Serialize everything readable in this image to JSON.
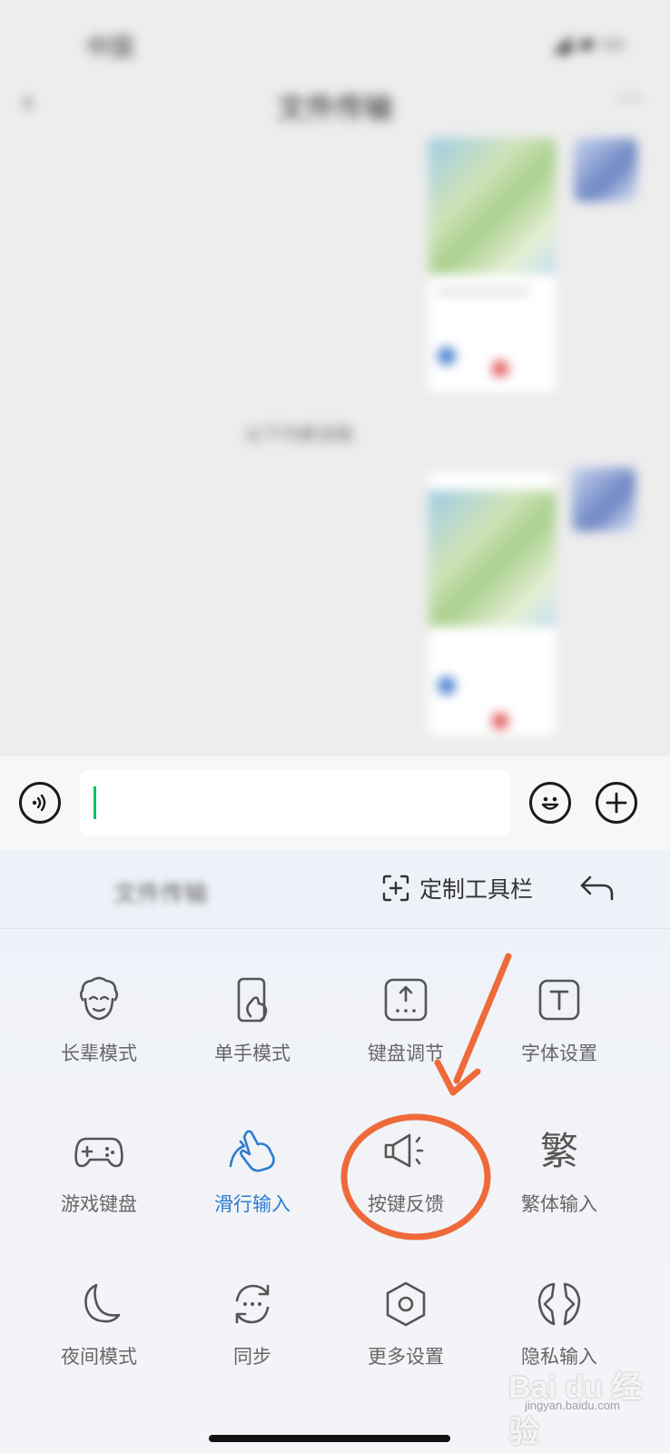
{
  "chat": {
    "status_time": "中国",
    "status_icons": "◢ ▰ ▭",
    "nav_back": "‹",
    "nav_title": "文件传输",
    "nav_more": "···",
    "system_notice": "以下为新消息"
  },
  "input_bar": {
    "voice_icon": "voice-icon",
    "emoji_icon": "emoji-icon",
    "plus_icon": "plus-icon"
  },
  "keyboard_panel": {
    "candidate_text": "文件传输",
    "customize_label": "定制工具栏",
    "items": [
      {
        "label": "长辈模式",
        "icon": "elder-icon",
        "active": false
      },
      {
        "label": "单手模式",
        "icon": "one-hand-icon",
        "active": false
      },
      {
        "label": "键盘调节",
        "icon": "keyboard-adjust-icon",
        "active": false
      },
      {
        "label": "字体设置",
        "icon": "font-icon",
        "active": false
      },
      {
        "label": "游戏键盘",
        "icon": "gamepad-icon",
        "active": false
      },
      {
        "label": "滑行输入",
        "icon": "swipe-hand-icon",
        "active": true
      },
      {
        "label": "按键反馈",
        "icon": "speaker-icon",
        "active": false
      },
      {
        "label": "繁体输入",
        "icon": "traditional-char-icon",
        "active": false,
        "glyph": "繁"
      },
      {
        "label": "夜间模式",
        "icon": "moon-icon",
        "active": false
      },
      {
        "label": "同步",
        "icon": "sync-icon",
        "active": false
      },
      {
        "label": "更多设置",
        "icon": "hexagon-settings-icon",
        "active": false
      },
      {
        "label": "隐私输入",
        "icon": "privacy-icon",
        "active": false
      }
    ]
  },
  "colors": {
    "accent": "#2e7ccf",
    "annotation": "#ef6a3a",
    "caret": "#07c160"
  },
  "watermark": {
    "brand": "Bai du 经验",
    "url": "jingyan.baidu.com"
  }
}
